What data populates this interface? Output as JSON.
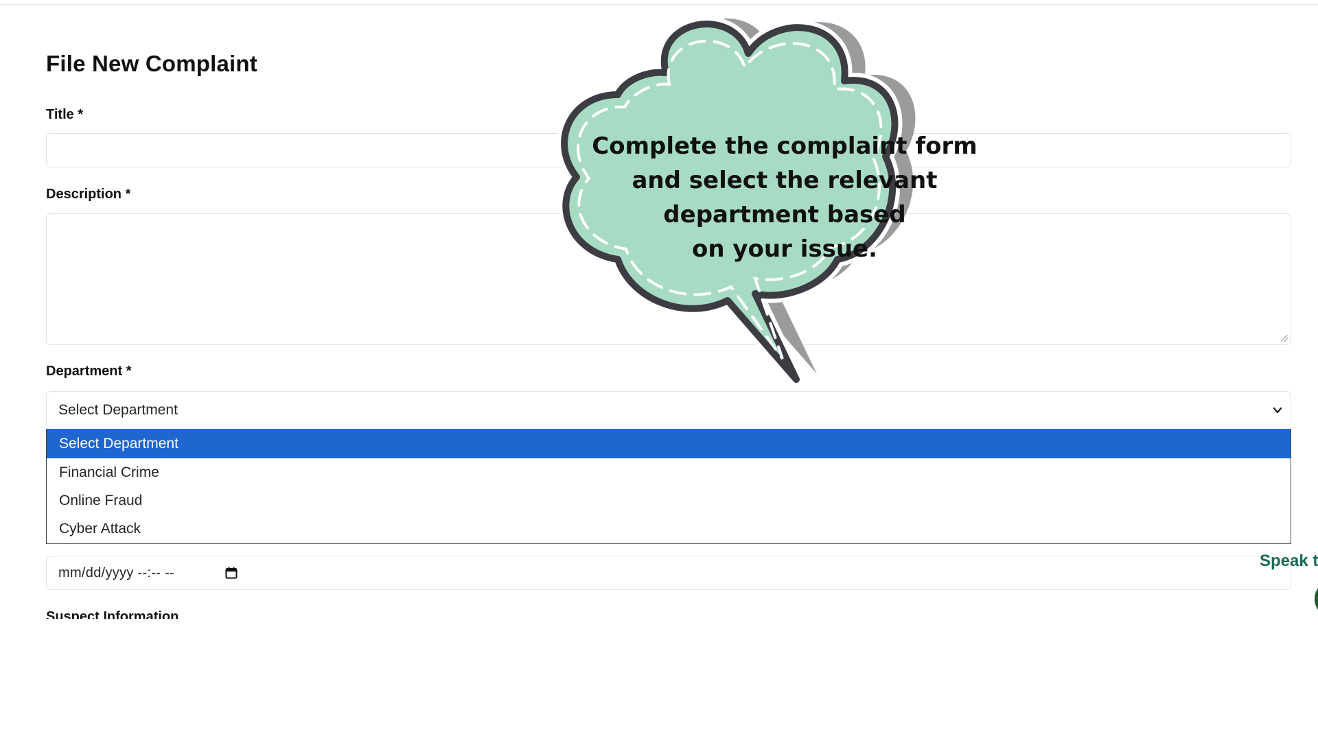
{
  "form": {
    "heading": "File New Complaint",
    "title_label": "Title *",
    "title_value": "",
    "description_label": "Description *",
    "description_value": "",
    "department_label": "Department *",
    "department_selected": "Select Department",
    "department_options": [
      "Select Department",
      "Financial Crime",
      "Online Fraud",
      "Cyber Attack"
    ],
    "date_placeholder": "mm/dd/yyyy --:-- --",
    "suspect_label": "Suspect Information"
  },
  "assistant": {
    "speak_label": "Speak t"
  },
  "tooltip": {
    "lines": [
      "Complete the complaint form",
      "and select the relevant",
      "department based",
      "on your issue."
    ]
  },
  "colors": {
    "bubble_fill": "#a8dbc4",
    "bubble_outline": "#3b3d42",
    "bubble_shadow": "#9b9b9b",
    "selected_option": "#1f66d1",
    "speak_text": "#1b6b55",
    "round_button": "#1f5a2c"
  },
  "icons": {
    "select_arrow": "chevron-down-icon",
    "date_picker": "calendar-icon"
  }
}
